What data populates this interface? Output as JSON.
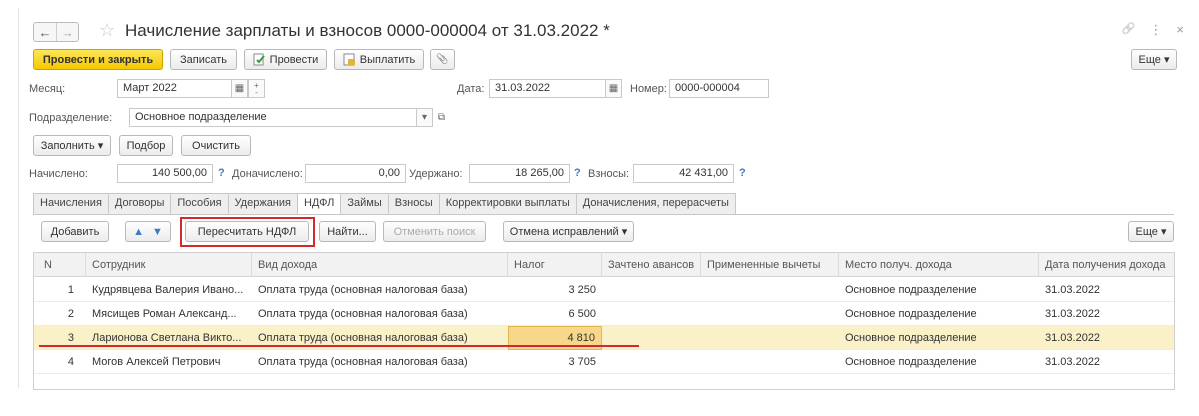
{
  "header": {
    "title": "Начисление зарплаты и взносов 0000-000004 от 31.03.2022 *",
    "back": "←",
    "forward": "→",
    "star": "☆",
    "link": "🔗",
    "menu": "⋮",
    "close": "×"
  },
  "toolbar": {
    "post_close": "Провести и закрыть",
    "save": "Записать",
    "post": "Провести",
    "pay": "Выплатить",
    "attach": "📎",
    "more": "Еще ▾"
  },
  "form": {
    "month_label": "Месяц:",
    "month_value": "Март 2022",
    "date_label": "Дата:",
    "date_value": "31.03.2022",
    "number_label": "Номер:",
    "number_value": "0000-000004",
    "dept_label": "Подразделение:",
    "dept_value": "Основное подразделение",
    "fill": "Заполнить ▾",
    "select": "Подбор",
    "clear": "Очистить",
    "accrued_label": "Начислено:",
    "accrued_value": "140 500,00",
    "extra_label": "Доначислено:",
    "extra_value": "0,00",
    "withheld_label": "Удержано:",
    "withheld_value": "18 265,00",
    "contrib_label": "Взносы:",
    "contrib_value": "42 431,00",
    "help": "?"
  },
  "tabs": [
    "Начисления",
    "Договоры",
    "Пособия",
    "Удержания",
    "НДФЛ",
    "Займы",
    "Взносы",
    "Корректировки выплаты",
    "Доначисления, перерасчеты"
  ],
  "table_toolbar": {
    "add": "Добавить",
    "up": "🡅",
    "down": "🡇",
    "recalc": "Пересчитать НДФЛ",
    "find": "Найти...",
    "cancel_search": "Отменить поиск",
    "cancel_fix": "Отмена исправлений ▾",
    "more": "Еще ▾"
  },
  "columns": [
    "N",
    "Сотрудник",
    "Вид дохода",
    "Налог",
    "Зачтено авансов",
    "Примененные вычеты",
    "Место получ. дохода",
    "Дата получения дохода"
  ],
  "rows": [
    {
      "n": "1",
      "employee": "Кудрявцева Валерия Ивано...",
      "income": "Оплата труда (основная налоговая база)",
      "tax": "3 250",
      "place": "Основное подразделение",
      "date": "31.03.2022"
    },
    {
      "n": "2",
      "employee": "Мясищев Роман Александ...",
      "income": "Оплата труда (основная налоговая база)",
      "tax": "6 500",
      "place": "Основное подразделение",
      "date": "31.03.2022"
    },
    {
      "n": "3",
      "employee": "Ларионова Светлана Викто...",
      "income": "Оплата труда (основная налоговая база)",
      "tax": "4 810",
      "place": "Основное подразделение",
      "date": "31.03.2022"
    },
    {
      "n": "4",
      "employee": "Могов Алексей Петрович",
      "income": "Оплата труда (основная налоговая база)",
      "tax": "3 705",
      "place": "Основное подразделение",
      "date": "31.03.2022"
    }
  ]
}
